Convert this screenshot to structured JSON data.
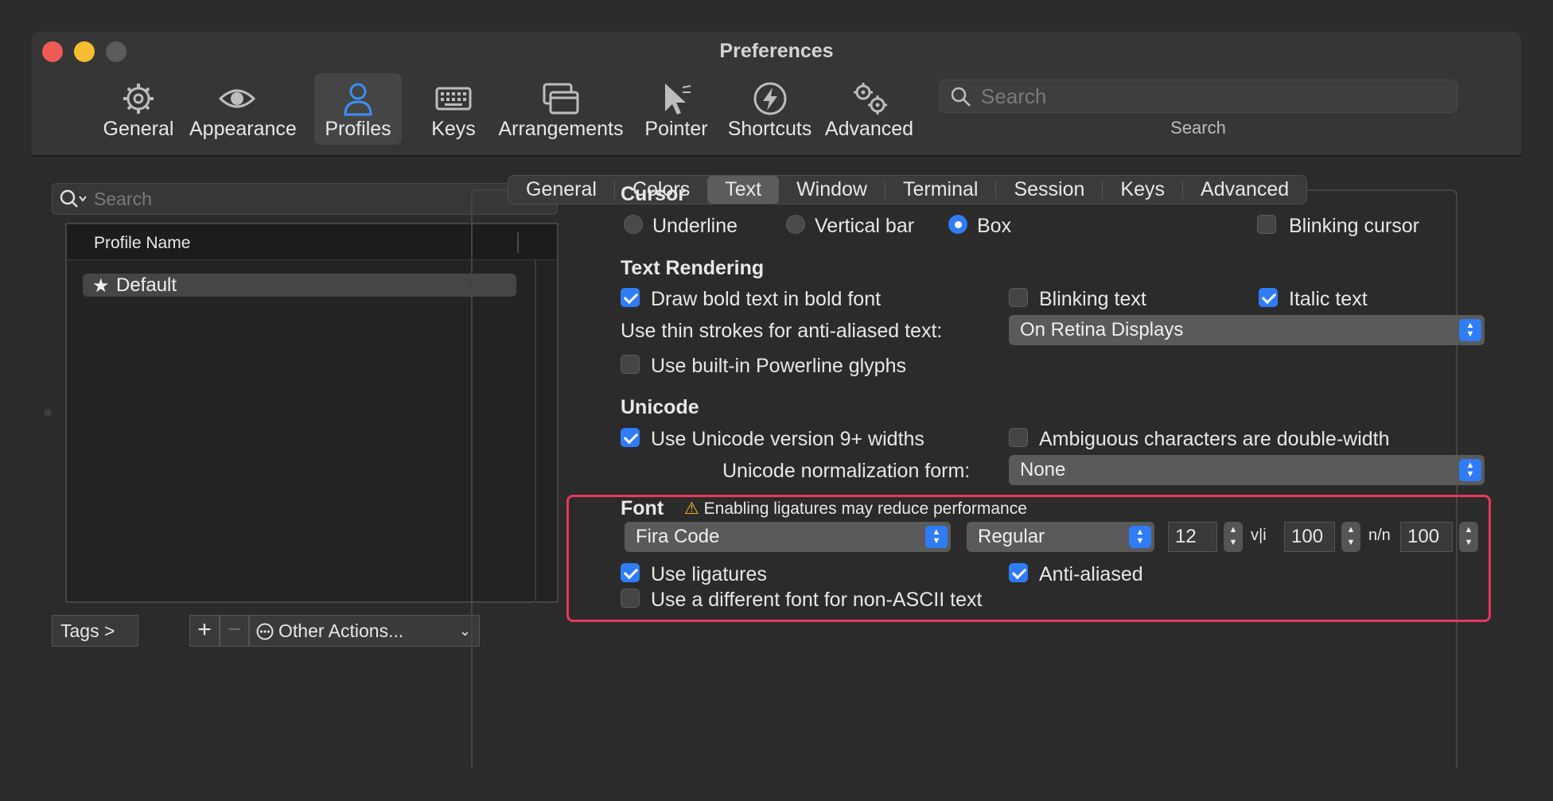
{
  "window": {
    "title": "Preferences"
  },
  "toolbar": {
    "items": [
      {
        "label": "General",
        "icon": "gear-icon"
      },
      {
        "label": "Appearance",
        "icon": "eye-icon"
      },
      {
        "label": "Profiles",
        "icon": "person-icon",
        "active": true
      },
      {
        "label": "Keys",
        "icon": "keyboard-icon"
      },
      {
        "label": "Arrangements",
        "icon": "windows-icon"
      },
      {
        "label": "Pointer",
        "icon": "pointer-icon"
      },
      {
        "label": "Shortcuts",
        "icon": "bolt-icon"
      },
      {
        "label": "Advanced",
        "icon": "gears-icon"
      }
    ],
    "search_placeholder": "Search",
    "search_label": "Search",
    "accent": "#3d8ef7"
  },
  "sidebar": {
    "search_placeholder": "Search",
    "table_header": "Profile Name",
    "profiles": [
      {
        "name": "Default",
        "icon": "star-icon",
        "selected": true
      }
    ],
    "tags_button": "Tags >",
    "add_button": "+",
    "remove_button": "−",
    "other_actions": "Other Actions..."
  },
  "tabs": [
    {
      "label": "General"
    },
    {
      "label": "Colors"
    },
    {
      "label": "Text",
      "active": true
    },
    {
      "label": "Window"
    },
    {
      "label": "Terminal"
    },
    {
      "label": "Session"
    },
    {
      "label": "Keys"
    },
    {
      "label": "Advanced"
    }
  ],
  "cursor": {
    "title": "Cursor",
    "underline": "Underline",
    "vertical_bar": "Vertical bar",
    "box": "Box",
    "selected": "Box",
    "blinking": {
      "label": "Blinking cursor",
      "checked": false
    }
  },
  "text_rendering": {
    "title": "Text Rendering",
    "bold": {
      "label": "Draw bold text in bold font",
      "checked": true
    },
    "blinking_text": {
      "label": "Blinking text",
      "checked": false
    },
    "italic": {
      "label": "Italic text",
      "checked": true
    },
    "thin_strokes_label": "Use thin strokes for anti-aliased text:",
    "thin_strokes_value": "On Retina Displays",
    "powerline": {
      "label": "Use built-in Powerline glyphs",
      "checked": false
    }
  },
  "unicode": {
    "title": "Unicode",
    "v9_widths": {
      "label": "Use Unicode version 9+ widths",
      "checked": true
    },
    "ambiguous": {
      "label": "Ambiguous characters are double-width",
      "checked": false
    },
    "normalization_label": "Unicode normalization form:",
    "normalization_value": "None"
  },
  "font": {
    "title": "Font",
    "warning": "Enabling ligatures may reduce performance",
    "family": "Fira Code",
    "weight": "Regular",
    "size": "12",
    "hspacing_icon": "v|i",
    "hspacing": "100",
    "vspacing_icon": "n/n",
    "vspacing": "100",
    "ligatures": {
      "label": "Use ligatures",
      "checked": true
    },
    "anti_aliased": {
      "label": "Anti-aliased",
      "checked": true
    },
    "non_ascii": {
      "label": "Use a different font for non-ASCII text",
      "checked": false
    },
    "highlight_color": "#e8375f"
  }
}
